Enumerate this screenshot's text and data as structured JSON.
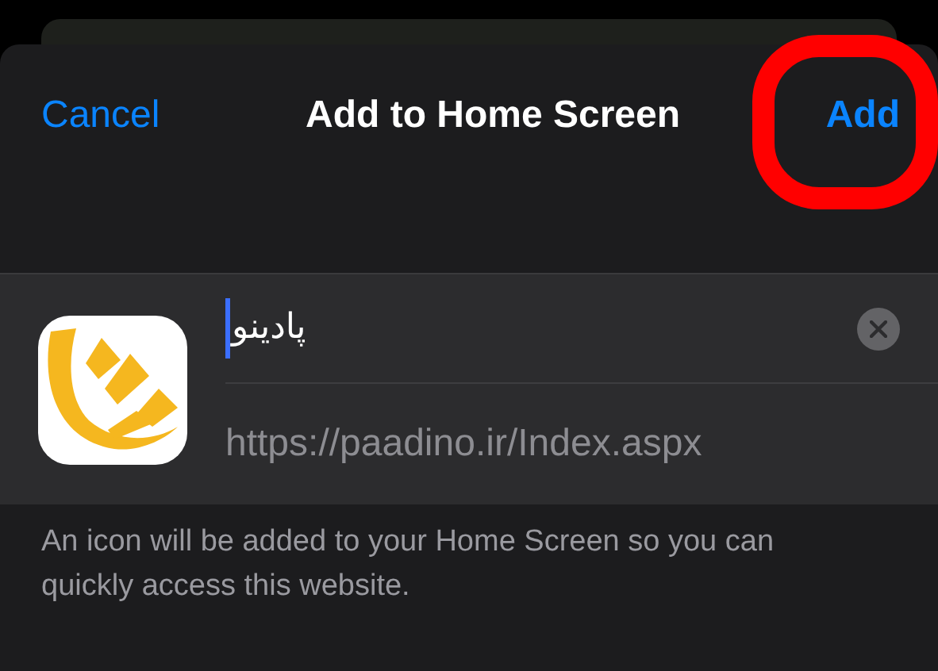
{
  "header": {
    "cancel": "Cancel",
    "title": "Add to Home Screen",
    "add": "Add"
  },
  "bookmark": {
    "name": "پادینو",
    "url": "https://paadino.ir/Index.aspx"
  },
  "footer": "An icon will be added to your Home Screen so you can quickly access this website."
}
